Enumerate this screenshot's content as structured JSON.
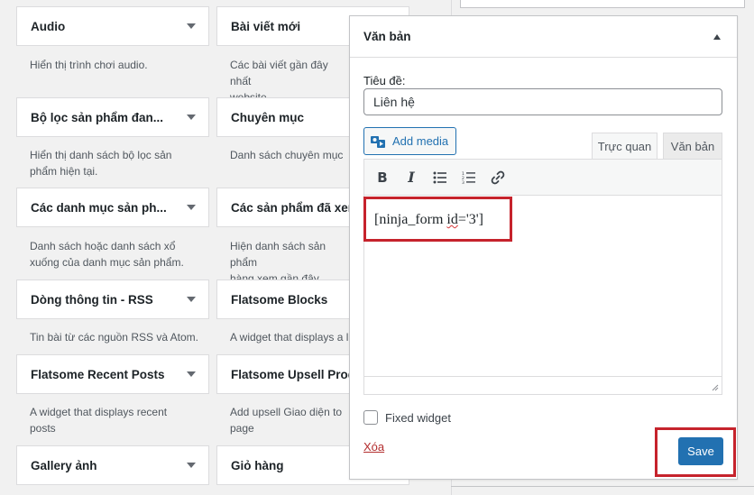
{
  "widgets": [
    {
      "title": "Audio",
      "desc": "Hiển thị trình chơi audio."
    },
    {
      "title": "Bài viết mới",
      "desc": "Các bài viết gần đây nhất\nwebsite"
    },
    {
      "title": "Bộ lọc sản phẩm đan...",
      "desc": "Hiển thị danh sách bộ lọc sản\nphẩm hiện tại."
    },
    {
      "title": "Chuyên mục",
      "desc": "Danh sách chuyên mục"
    },
    {
      "title": "Các danh mục sản ph...",
      "desc": "Danh sách hoặc danh sách xổ\nxuống của danh mục sản phẩm."
    },
    {
      "title": "Các sản phẩm đã xem...",
      "desc": "Hiện danh sách sản phẩm\nhàng xem gần đây"
    },
    {
      "title": "Dòng thông tin - RSS",
      "desc": "Tin bài từ các nguồn RSS và Atom."
    },
    {
      "title": "Flatsome Blocks",
      "desc": "A widget that displays a l"
    },
    {
      "title": "Flatsome Recent Posts",
      "desc": "A widget that displays recent\nposts"
    },
    {
      "title": "Flatsome Upsell Prod...",
      "desc": "Add upsell Giao diện to\npage"
    },
    {
      "title": "Gallery ảnh",
      "desc": ""
    },
    {
      "title": "Giỏ hàng",
      "desc": ""
    }
  ],
  "panel": {
    "header_title": "Văn bản",
    "title_label": "Tiêu đề:",
    "title_value": "Liên hệ",
    "add_media_label": "Add media",
    "tab_visual": "Trực quan",
    "tab_text": "Văn bản",
    "content_before": "[ninja_form ",
    "content_spell": "id",
    "content_after": "='3']",
    "fixed_widget_label": "Fixed widget",
    "delete_label": "Xóa",
    "save_label": "Save"
  },
  "colors": {
    "accent": "#2271b1",
    "highlight": "#c6232c",
    "delete": "#b32d2e"
  },
  "icons": {
    "toolbar": [
      "bold-icon",
      "italic-icon",
      "bullet-list-icon",
      "numbered-list-icon",
      "link-icon"
    ]
  }
}
